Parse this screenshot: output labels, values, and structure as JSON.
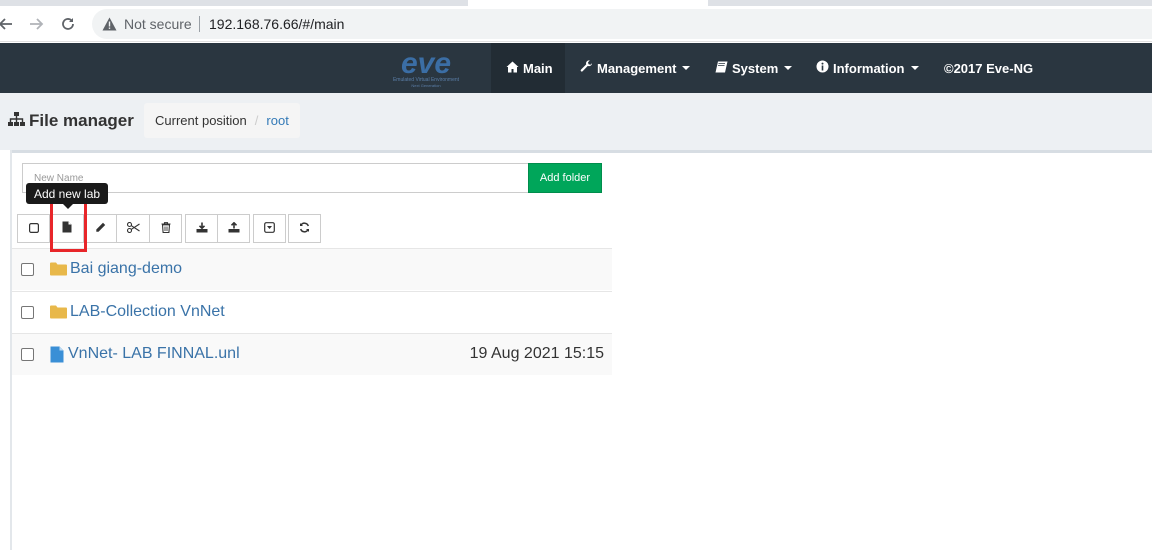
{
  "browser": {
    "security_label": "Not secure",
    "url": "192.168.76.66/#/main"
  },
  "navbar": {
    "logo_text": "eve",
    "logo_subtitle": "Emulated Virtual Environment",
    "logo_subtitle2": "Next Generation",
    "items": [
      {
        "label": "Main",
        "icon": "home-icon",
        "dropdown": false
      },
      {
        "label": "Management",
        "icon": "wrench-icon",
        "dropdown": true
      },
      {
        "label": "System",
        "icon": "book-icon",
        "dropdown": true
      },
      {
        "label": "Information",
        "icon": "info-circle-icon",
        "dropdown": true
      }
    ],
    "copyright": "©2017 Eve-NG"
  },
  "header": {
    "title": "File manager",
    "breadcrumb_label": "Current position",
    "breadcrumb_separator": "/",
    "breadcrumb_current": "root"
  },
  "new_folder": {
    "placeholder": "New Name",
    "button_label": "Add folder"
  },
  "tooltip": "Add new lab",
  "toolbar": [
    {
      "name": "select-all",
      "icon": "checkbox-icon"
    },
    {
      "name": "add-new-lab",
      "icon": "file-icon"
    },
    {
      "name": "rename",
      "icon": "pencil-icon"
    },
    {
      "name": "move",
      "icon": "scissors-icon"
    },
    {
      "name": "delete",
      "icon": "trash-icon"
    },
    {
      "name": "export",
      "icon": "download-icon"
    },
    {
      "name": "import",
      "icon": "upload-icon"
    },
    {
      "name": "expand",
      "icon": "caret-square-icon"
    },
    {
      "name": "refresh",
      "icon": "refresh-icon"
    }
  ],
  "files": [
    {
      "type": "folder",
      "name": "Bai giang-demo",
      "date": ""
    },
    {
      "type": "folder",
      "name": "LAB-Collection VnNet",
      "date": ""
    },
    {
      "type": "file",
      "name": "VnNet- LAB FINNAL.unl",
      "date": "19 Aug 2021 15:15"
    }
  ],
  "colors": {
    "navbar_bg": "#2a3640",
    "accent_green": "#00a65a",
    "link_blue": "#3a73a8",
    "folder_yellow": "#e8b84a",
    "file_blue": "#3a8fd6",
    "highlight_red": "#e8262a"
  }
}
